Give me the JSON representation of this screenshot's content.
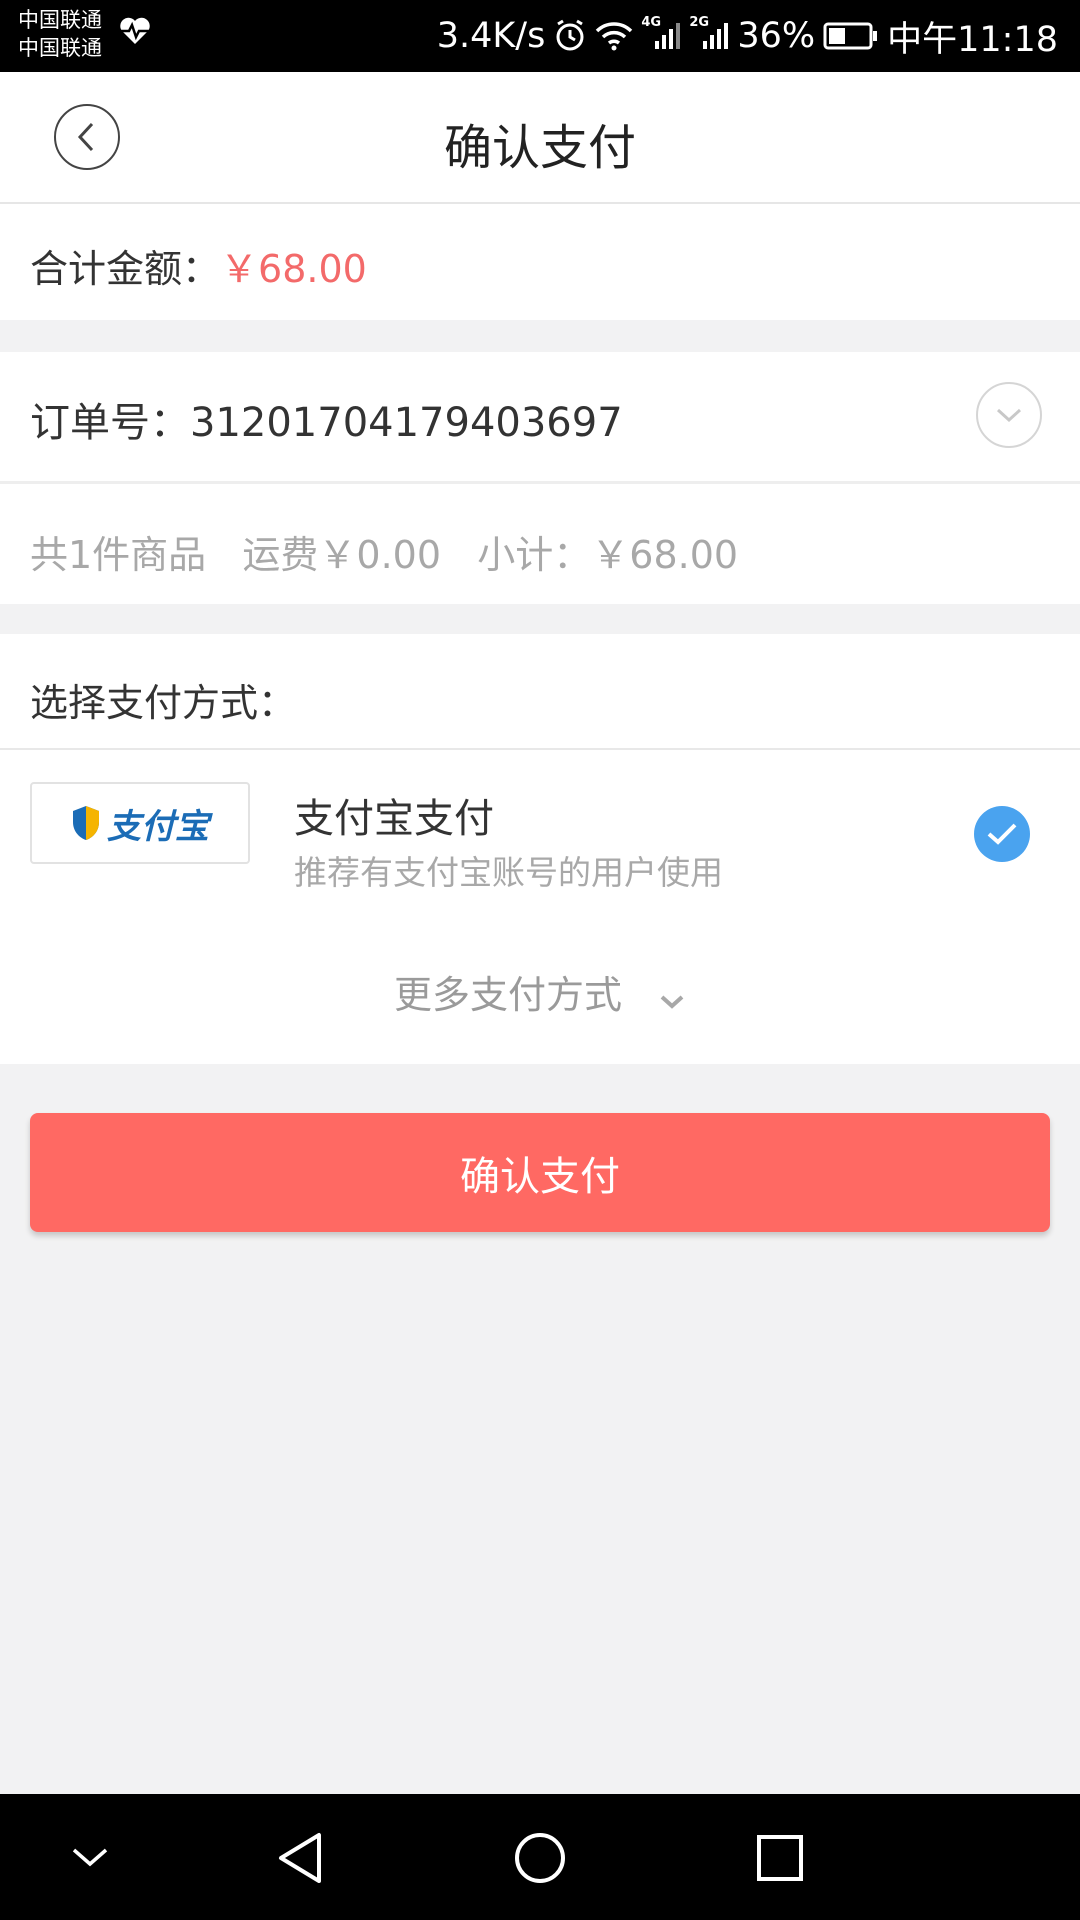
{
  "status_bar": {
    "carrier_1": "中国联通",
    "carrier_2": "中国联通",
    "net_speed": "3.4K/s",
    "net_1": "4G",
    "net_2": "2G",
    "battery": "36%",
    "time": "中午11:18",
    "icons": [
      "heartbeat-icon",
      "alarm-icon",
      "wifi-icon",
      "signal-icon",
      "battery-icon"
    ]
  },
  "header": {
    "title": "确认支付",
    "back_icon": "chevron-left-icon"
  },
  "total": {
    "label": "合计金额：",
    "amount": "￥68.00"
  },
  "order": {
    "label": "订单号：",
    "number": "312017041794036 97",
    "expand_icon": "chevron-down-icon"
  },
  "summary": {
    "text": "共1件商品   运费￥0.00   小计：￥68.00"
  },
  "payment": {
    "header": "选择支付方式：",
    "method": {
      "logo_text": "支付宝",
      "title": "支付宝支付",
      "subtitle": "推荐有支付宝账号的用户使用",
      "selected": true
    },
    "more_label": "更多支付方式"
  },
  "confirm_button": {
    "label": "确认支付"
  },
  "colors": {
    "accent": "#ff6963",
    "price": "#f36a6a",
    "check": "#4aa3ef"
  },
  "system_nav": [
    "collapse-icon",
    "back-triangle-icon",
    "home-circle-icon",
    "recents-square-icon"
  ]
}
